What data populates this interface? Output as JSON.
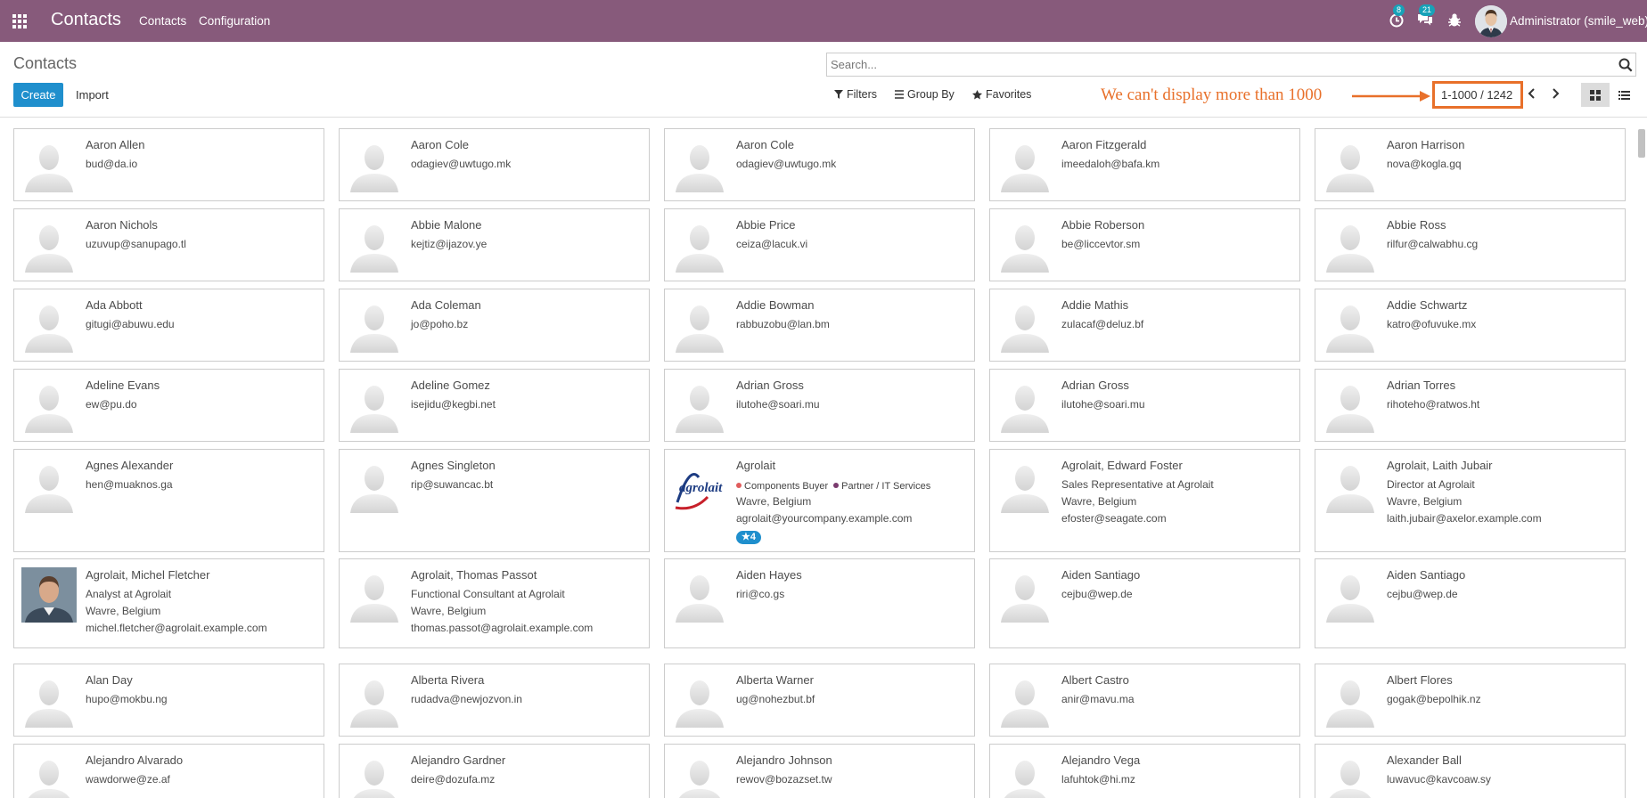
{
  "navbar": {
    "app_title": "Contacts",
    "menu": [
      "Contacts",
      "Configuration"
    ],
    "activity_count": "8",
    "message_count": "21",
    "user": "Administrator (smile_web)"
  },
  "control_panel": {
    "title": "Contacts",
    "search_placeholder": "Search...",
    "create_label": "Create",
    "import_label": "Import",
    "filters_label": "Filters",
    "groupby_label": "Group By",
    "favorites_label": "Favorites",
    "annotation": "We can't display more than 1000",
    "pager": "1-1000 / 1242",
    "active_view": "kanban"
  },
  "colors": {
    "navbar": "#875a7b",
    "primary": "#1f8fcd",
    "annotation": "#e8702a"
  },
  "cards": [
    [
      {
        "name": "Aaron Allen",
        "lines": [
          "bud@da.io"
        ]
      },
      {
        "name": "Aaron Cole",
        "lines": [
          "odagiev@uwtugo.mk"
        ]
      },
      {
        "name": "Aaron Cole",
        "lines": [
          "odagiev@uwtugo.mk"
        ]
      },
      {
        "name": "Aaron Fitzgerald",
        "lines": [
          "imeedaloh@bafa.km"
        ]
      },
      {
        "name": "Aaron Harrison",
        "lines": [
          "nova@kogla.gq"
        ]
      }
    ],
    [
      {
        "name": "Aaron Nichols",
        "lines": [
          "uzuvup@sanupago.tl"
        ]
      },
      {
        "name": "Abbie Malone",
        "lines": [
          "kejtiz@ijazov.ye"
        ]
      },
      {
        "name": "Abbie Price",
        "lines": [
          "ceiza@lacuk.vi"
        ]
      },
      {
        "name": "Abbie Roberson",
        "lines": [
          "be@liccevtor.sm"
        ]
      },
      {
        "name": "Abbie Ross",
        "lines": [
          "rilfur@calwabhu.cg"
        ]
      }
    ],
    [
      {
        "name": "Ada Abbott",
        "lines": [
          "gitugi@abuwu.edu"
        ]
      },
      {
        "name": "Ada Coleman",
        "lines": [
          "jo@poho.bz"
        ]
      },
      {
        "name": "Addie Bowman",
        "lines": [
          "rabbuzobu@lan.bm"
        ]
      },
      {
        "name": "Addie Mathis",
        "lines": [
          "zulacaf@deluz.bf"
        ]
      },
      {
        "name": "Addie Schwartz",
        "lines": [
          "katro@ofuvuke.mx"
        ]
      }
    ],
    [
      {
        "name": "Adeline Evans",
        "lines": [
          "ew@pu.do"
        ]
      },
      {
        "name": "Adeline Gomez",
        "lines": [
          "isejidu@kegbi.net"
        ]
      },
      {
        "name": "Adrian Gross",
        "lines": [
          "ilutohe@soari.mu"
        ]
      },
      {
        "name": "Adrian Gross",
        "lines": [
          "ilutohe@soari.mu"
        ]
      },
      {
        "name": "Adrian Torres",
        "lines": [
          "rihoteho@ratwos.ht"
        ]
      }
    ],
    [
      {
        "name": "Agnes Alexander",
        "lines": [
          "hen@muaknos.ga"
        ]
      },
      {
        "name": "Agnes Singleton",
        "lines": [
          "rip@suwancac.bt"
        ]
      },
      {
        "name": "Agrolait",
        "logo": "agrolait",
        "tags": [
          {
            "label": "Components Buyer",
            "color": "#e05d5d"
          },
          {
            "label": "Partner / IT Services",
            "color": "#7a3b6e"
          }
        ],
        "lines": [
          "Wavre, Belgium",
          "agrolait@yourcompany.example.com"
        ],
        "stars": "4"
      },
      {
        "name": "Agrolait, Edward Foster",
        "lines": [
          "Sales Representative at Agrolait",
          "Wavre, Belgium",
          "efoster@seagate.com"
        ]
      },
      {
        "name": "Agrolait, Laith Jubair",
        "lines": [
          "Director at Agrolait",
          "Wavre, Belgium",
          "laith.jubair@axelor.example.com"
        ]
      }
    ],
    [
      {
        "name": "Agrolait, Michel Fletcher",
        "photo": true,
        "lines": [
          "Analyst at Agrolait",
          "Wavre, Belgium",
          "michel.fletcher@agrolait.example.com"
        ]
      },
      {
        "name": "Agrolait, Thomas Passot",
        "lines": [
          "Functional Consultant at Agrolait",
          "Wavre, Belgium",
          "thomas.passot@agrolait.example.com"
        ]
      },
      {
        "name": "Aiden Hayes",
        "lines": [
          "riri@co.gs"
        ]
      },
      {
        "name": "Aiden Santiago",
        "lines": [
          "cejbu@wep.de"
        ]
      },
      {
        "name": "Aiden Santiago",
        "lines": [
          "cejbu@wep.de"
        ]
      }
    ],
    [
      {
        "name": "Alan Day",
        "lines": [
          "hupo@mokbu.ng"
        ]
      },
      {
        "name": "Alberta Rivera",
        "lines": [
          "rudadva@newjozvon.in"
        ]
      },
      {
        "name": "Alberta Warner",
        "lines": [
          "ug@nohezbut.bf"
        ]
      },
      {
        "name": "Albert Castro",
        "lines": [
          "anir@mavu.ma"
        ]
      },
      {
        "name": "Albert Flores",
        "lines": [
          "gogak@bepolhik.nz"
        ]
      }
    ],
    [
      {
        "name": "Alejandro Alvarado",
        "lines": [
          "wawdorwe@ze.af"
        ]
      },
      {
        "name": "Alejandro Gardner",
        "lines": [
          "deire@dozufa.mz"
        ]
      },
      {
        "name": "Alejandro Johnson",
        "lines": [
          "rewov@bozazset.tw"
        ]
      },
      {
        "name": "Alejandro Vega",
        "lines": [
          "lafuhtok@hi.mz"
        ]
      },
      {
        "name": "Alexander Ball",
        "lines": [
          "luwavuc@kavcoaw.sy"
        ]
      }
    ]
  ]
}
